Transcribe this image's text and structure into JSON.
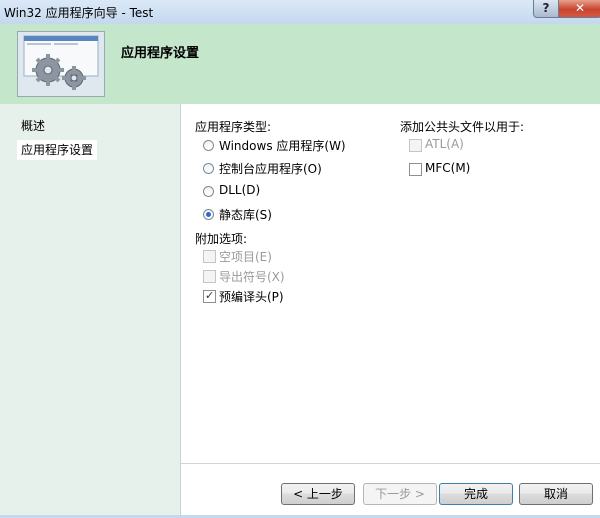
{
  "window": {
    "title": "Win32 应用程序向导 - Test",
    "help_glyph": "?",
    "close_glyph": "✕"
  },
  "header": {
    "title": "应用程序设置"
  },
  "nav": {
    "items": [
      {
        "label": "概述"
      },
      {
        "label": "应用程序设置"
      }
    ]
  },
  "app_type": {
    "label": "应用程序类型:",
    "options": [
      {
        "label": "Windows 应用程序(W)",
        "selected": false
      },
      {
        "label": "控制台应用程序(O)",
        "selected": false
      },
      {
        "label": "DLL(D)",
        "selected": false
      },
      {
        "label": "静态库(S)",
        "selected": true
      }
    ]
  },
  "extra": {
    "label": "附加选项:",
    "options": [
      {
        "label": "空项目(E)",
        "checked": false,
        "enabled": false
      },
      {
        "label": "导出符号(X)",
        "checked": false,
        "enabled": false
      },
      {
        "label": "预编译头(P)",
        "checked": true,
        "enabled": true
      }
    ]
  },
  "headers": {
    "label": "添加公共头文件以用于:",
    "options": [
      {
        "label": "ATL(A)",
        "checked": false,
        "enabled": false
      },
      {
        "label": "MFC(M)",
        "checked": false,
        "enabled": true
      }
    ]
  },
  "buttons": {
    "back": "< 上一步",
    "next": "下一步 >",
    "finish": "完成",
    "cancel": "取消"
  }
}
